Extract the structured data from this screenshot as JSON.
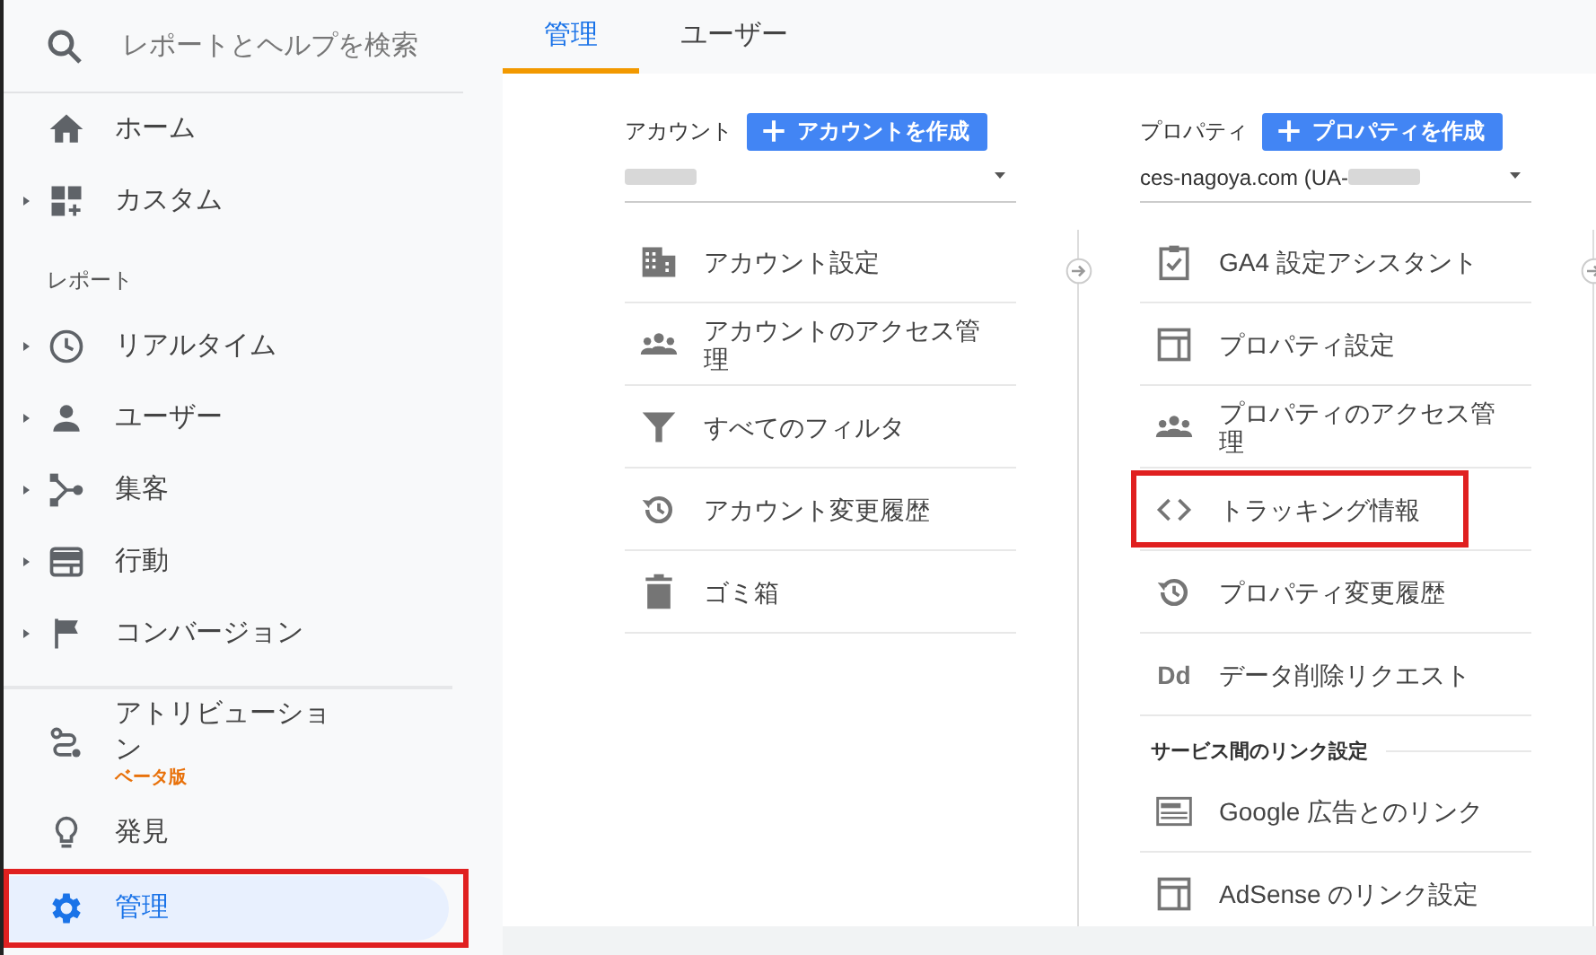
{
  "sidebar": {
    "search": {
      "placeholder": "レポートとヘルプを検索"
    },
    "sections": [
      {
        "separated": false,
        "items": [
          {
            "label": "ホーム",
            "expandable": false,
            "selected": false,
            "highlighted": false
          },
          {
            "label": "カスタム",
            "expandable": true,
            "selected": false,
            "highlighted": false
          }
        ]
      },
      {
        "separated": false,
        "heading": "レポート",
        "items": [
          {
            "label": "リアルタイム",
            "expandable": true,
            "selected": false,
            "highlighted": false
          },
          {
            "label": "ユーザー",
            "expandable": true,
            "selected": false,
            "highlighted": false
          },
          {
            "label": "集客",
            "expandable": true,
            "selected": false,
            "highlighted": false
          },
          {
            "label": "行動",
            "expandable": true,
            "selected": false,
            "highlighted": false
          },
          {
            "label": "コンバージョン",
            "expandable": true,
            "selected": false,
            "highlighted": false
          }
        ]
      },
      {
        "separated": true,
        "items": [
          {
            "label": "アトリビューション",
            "badge": "ベータ版",
            "expandable": false,
            "selected": false,
            "highlighted": false
          },
          {
            "label": "発見",
            "expandable": false,
            "selected": false,
            "highlighted": false
          },
          {
            "label": "管理",
            "expandable": false,
            "selected": true,
            "highlighted": true
          }
        ]
      }
    ]
  },
  "tabs": [
    {
      "label": "管理",
      "selected": true
    },
    {
      "label": "ユーザー",
      "selected": false
    }
  ],
  "columns": [
    {
      "heading": "アカウント",
      "create_button": "アカウントを作成",
      "selector": {
        "redacted": true
      },
      "items": [
        {
          "kind": "item",
          "label": "アカウント設定",
          "highlighted": false
        },
        {
          "kind": "item",
          "label": "アカウントのアクセス管理",
          "highlighted": false
        },
        {
          "kind": "item",
          "label": "すべてのフィルタ",
          "highlighted": false
        },
        {
          "kind": "item",
          "label": "アカウント変更履歴",
          "highlighted": false
        },
        {
          "kind": "item",
          "label": "ゴミ箱",
          "highlighted": false
        }
      ]
    },
    {
      "heading": "プロパティ",
      "create_button": "プロパティを作成",
      "selector": {
        "value": "ces-nagoya.com (UA-",
        "redacted": true
      },
      "items": [
        {
          "kind": "item",
          "label": "GA4 設定アシスタント",
          "highlighted": false
        },
        {
          "kind": "item",
          "label": "プロパティ設定",
          "highlighted": false
        },
        {
          "kind": "item",
          "label": "プロパティのアクセス管理",
          "highlighted": false
        },
        {
          "kind": "item",
          "label": "トラッキング情報",
          "highlighted": true
        },
        {
          "kind": "item",
          "label": "プロパティ変更履歴",
          "highlighted": false
        },
        {
          "kind": "item",
          "label": "データ削除リクエスト",
          "icon_text": "Dd",
          "highlighted": false
        },
        {
          "kind": "subheading",
          "label": "サービス間のリンク設定"
        },
        {
          "kind": "item",
          "label": "Google 広告とのリンク",
          "highlighted": false
        },
        {
          "kind": "item",
          "label": "AdSense のリンク設定",
          "highlighted": false
        }
      ]
    }
  ]
}
